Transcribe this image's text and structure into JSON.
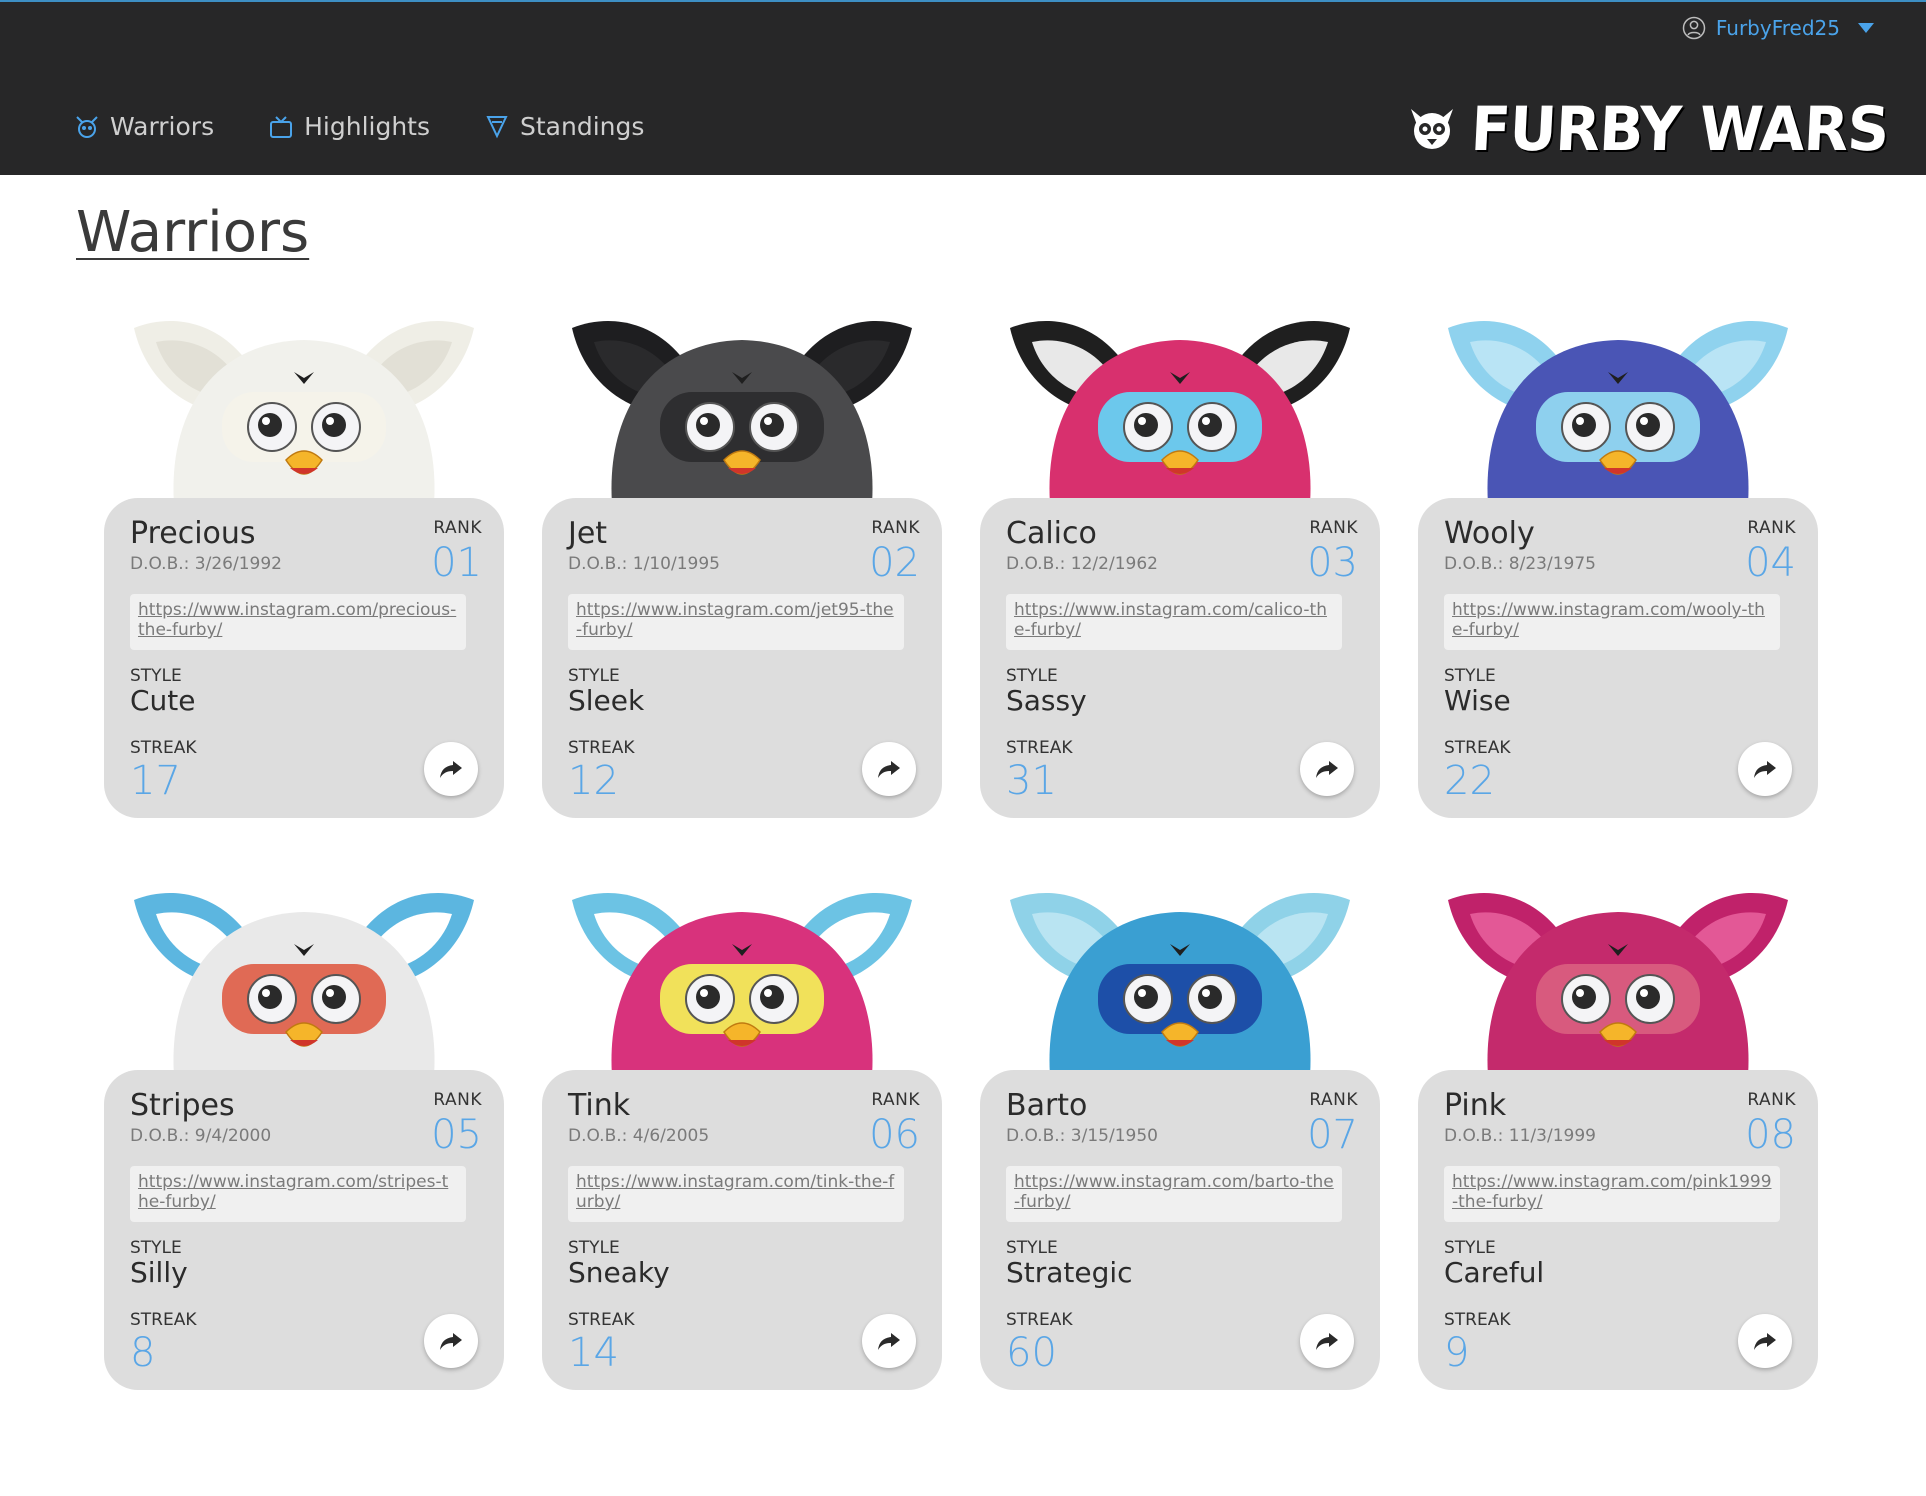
{
  "header": {
    "username": "FurbyFred25",
    "nav": [
      {
        "label": "Warriors",
        "icon": "furby-icon"
      },
      {
        "label": "Highlights",
        "icon": "tv-icon"
      },
      {
        "label": "Standings",
        "icon": "trophy-icon"
      }
    ],
    "logo_text": "FURBY WARS"
  },
  "page": {
    "title": "Warriors"
  },
  "labels": {
    "rank": "RANK",
    "style": "STYLE",
    "streak": "STREAK"
  },
  "warriors": [
    {
      "name": "Precious",
      "dob": "D.O.B.: 3/26/1992",
      "rank": "01",
      "link": "https://www.instagram.com/precious-the-furby/",
      "style": "Cute",
      "streak": "17",
      "fur": "#f1f1ec",
      "ears": "#efeee6",
      "ear_inner": "#e2e0d6",
      "mask": "#f5f3ea",
      "colors": {
        "fur": "#f1f1ec"
      }
    },
    {
      "name": "Jet",
      "dob": "D.O.B.: 1/10/1995",
      "rank": "02",
      "link": "https://www.instagram.com/jet95-the-furby/",
      "style": "Sleek",
      "streak": "12",
      "fur": "#4a4a4c",
      "ears": "#1e1e20",
      "ear_inner": "#2a2a2c",
      "mask": "#2e2e30"
    },
    {
      "name": "Calico",
      "dob": "D.O.B.: 12/2/1962",
      "rank": "03",
      "link": "https://www.instagram.com/calico-the-furby/",
      "style": "Sassy",
      "streak": "31",
      "fur": "#d8306e",
      "ears": "#1f1f1f",
      "ear_inner": "#e8e8e8",
      "mask": "#6cc8ec"
    },
    {
      "name": "Wooly",
      "dob": "D.O.B.: 8/23/1975",
      "rank": "04",
      "link": "https://www.instagram.com/wooly-the-furby/",
      "style": "Wise",
      "streak": "22",
      "fur": "#4a55b5",
      "ears": "#8fd2ee",
      "ear_inner": "#b9e4f5",
      "mask": "#8ed0ee"
    },
    {
      "name": "Stripes",
      "dob": "D.O.B.: 9/4/2000",
      "rank": "05",
      "link": "https://www.instagram.com/stripes-the-furby/",
      "style": "Silly",
      "streak": "8",
      "fur": "#e9e9e9",
      "ears": "#5cb6e0",
      "ear_inner": "#ffffff",
      "mask": "#e06a55"
    },
    {
      "name": "Tink",
      "dob": "D.O.B.: 4/6/2005",
      "rank": "06",
      "link": "https://www.instagram.com/tink-the-furby/",
      "style": "Sneaky",
      "streak": "14",
      "fur": "#d8327c",
      "ears": "#6cc3e4",
      "ear_inner": "#ffffff",
      "mask": "#f1e15a"
    },
    {
      "name": "Barto",
      "dob": "D.O.B.: 3/15/1950",
      "rank": "07",
      "link": "https://www.instagram.com/barto-the-furby/",
      "style": "Strategic",
      "streak": "60",
      "fur": "#3a9fd2",
      "ears": "#8fd2e8",
      "ear_inner": "#b9e4f2",
      "mask": "#1d4fa8"
    },
    {
      "name": "Pink",
      "dob": "D.O.B.: 11/3/1999",
      "rank": "08",
      "link": "https://www.instagram.com/pink1999-the-furby/",
      "style": "Careful",
      "streak": "9",
      "fur": "#c42a6c",
      "ears": "#c0226a",
      "ear_inner": "#e35896",
      "mask": "#d85a7e"
    }
  ]
}
